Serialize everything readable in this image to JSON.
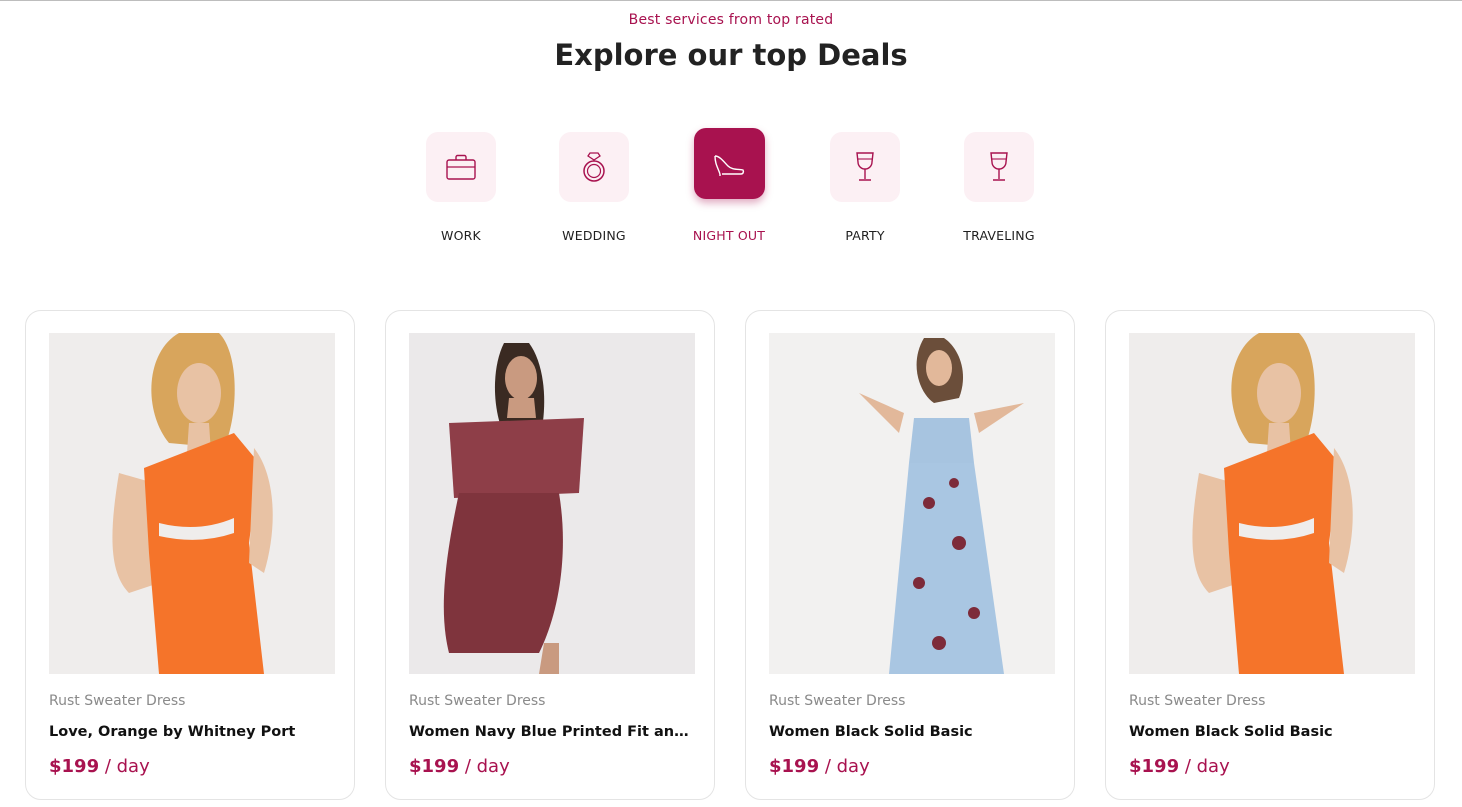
{
  "section": {
    "subtitle": "Best services from top rated",
    "title": "Explore our top Deals"
  },
  "categories": [
    {
      "label": "WORK",
      "icon": "briefcase-icon",
      "active": false
    },
    {
      "label": "WEDDING",
      "icon": "ring-icon",
      "active": false
    },
    {
      "label": "NIGHT OUT",
      "icon": "high-heel-icon",
      "active": true
    },
    {
      "label": "PARTY",
      "icon": "wine-glass-icon",
      "active": false
    },
    {
      "label": "TRAVELING",
      "icon": "wine-glass-icon",
      "active": false
    }
  ],
  "products": [
    {
      "category": "Rust Sweater Dress",
      "name": "Love, Orange by Whitney Port",
      "price": "$199",
      "unit": " / day"
    },
    {
      "category": "Rust Sweater Dress",
      "name": "Women Navy Blue Printed Fit and Flare Dress",
      "price": "$199",
      "unit": " / day"
    },
    {
      "category": "Rust Sweater Dress",
      "name": "Women Black Solid Basic",
      "price": "$199",
      "unit": " / day"
    },
    {
      "category": "Rust Sweater Dress",
      "name": "Women Black Solid Basic",
      "price": "$199",
      "unit": " / day"
    }
  ],
  "colors": {
    "accent": "#a8124f",
    "tile_bg": "#fcf0f4"
  }
}
